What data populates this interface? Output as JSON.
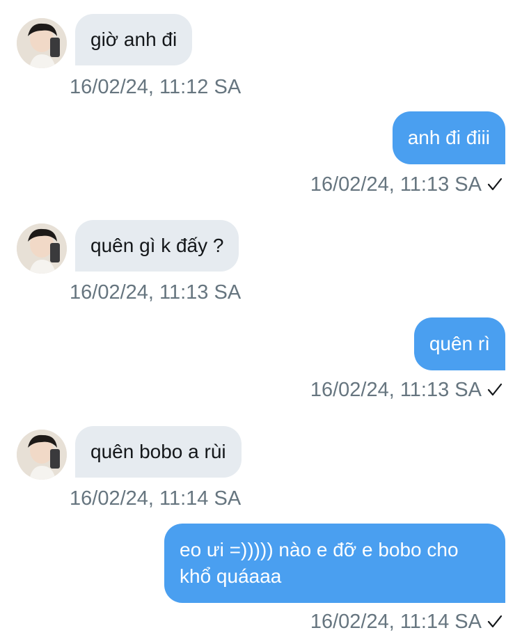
{
  "messages": [
    {
      "direction": "incoming",
      "text": "giờ anh đi",
      "time": "16/02/24, 11:12 SA"
    },
    {
      "direction": "outgoing",
      "text": "anh đi điii",
      "time": "16/02/24, 11:13 SA",
      "read_icon": "check-icon"
    },
    {
      "direction": "incoming",
      "text": "quên gì k đấy ?",
      "time": "16/02/24, 11:13 SA"
    },
    {
      "direction": "outgoing",
      "text": "quên rì",
      "time": "16/02/24, 11:13 SA",
      "read_icon": "check-icon"
    },
    {
      "direction": "incoming",
      "text": "quên bobo a rùi",
      "time": "16/02/24, 11:14 SA"
    },
    {
      "direction": "outgoing",
      "text": "eo ưi =))))) nào e đỡ e bobo cho khổ quáaaa",
      "time": "16/02/24, 11:14 SA",
      "read_icon": "check-icon"
    }
  ],
  "colors": {
    "outgoing_bubble": "#4a9ff0",
    "incoming_bubble": "#e6ebf0",
    "timestamp": "#66757f"
  }
}
